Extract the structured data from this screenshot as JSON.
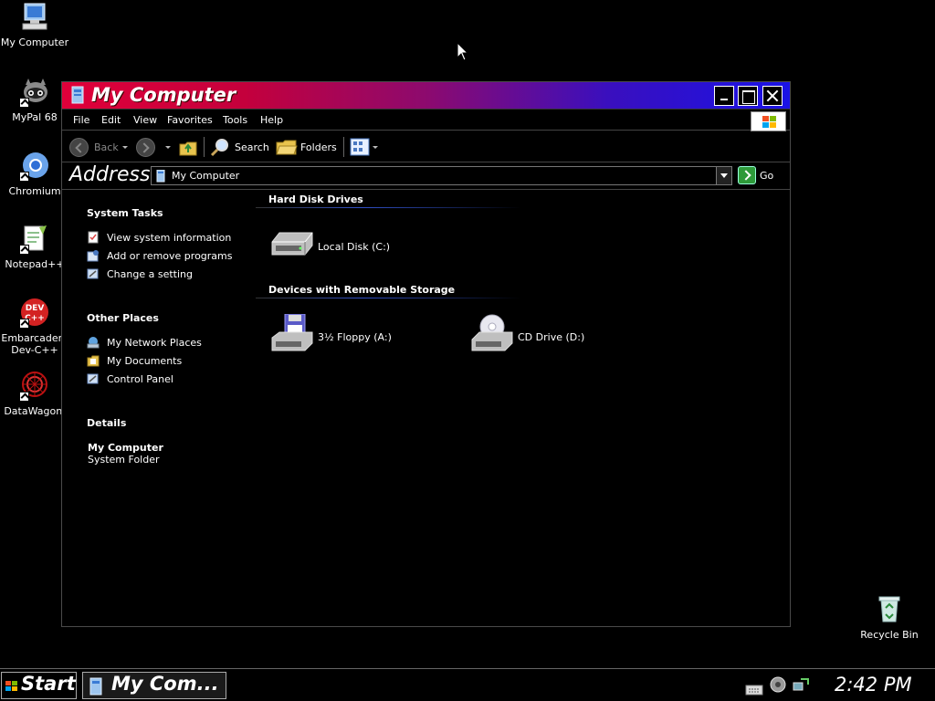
{
  "desktop": {
    "icons": [
      {
        "label": "My Computer"
      },
      {
        "label": "MyPal 68"
      },
      {
        "label": "Chromium"
      },
      {
        "label": "Notepad++"
      },
      {
        "label": "Embarcadero Dev-C++"
      },
      {
        "label": "DataWagon."
      },
      {
        "label": "Recycle Bin"
      }
    ]
  },
  "window": {
    "title": "My Computer",
    "menu": [
      "File",
      "Edit",
      "View",
      "Favorites",
      "Tools",
      "Help"
    ],
    "toolbar": {
      "back": "Back",
      "search": "Search",
      "folders": "Folders"
    },
    "address": {
      "label": "Address",
      "value": "My Computer",
      "go": "Go"
    },
    "taskpane": {
      "system_tasks": {
        "title": "System Tasks",
        "items": [
          "View system information",
          "Add or remove programs",
          "Change a setting"
        ]
      },
      "other_places": {
        "title": "Other Places",
        "items": [
          "My Network Places",
          "My Documents",
          "Control Panel"
        ]
      },
      "details": {
        "title": "Details",
        "name": "My Computer",
        "type": "System Folder"
      }
    },
    "groups": [
      {
        "title": "Hard Disk Drives",
        "items": [
          "Local Disk (C:)"
        ]
      },
      {
        "title": "Devices with Removable Storage",
        "items": [
          "3½ Floppy (A:)",
          "CD Drive (D:)"
        ]
      }
    ]
  },
  "taskbar": {
    "start": "Start",
    "task": "My Com...",
    "clock": "2:42 PM"
  },
  "colors": {
    "title_start": "#e0003a",
    "title_end": "#1a13e6",
    "group_line": "#3050c8"
  }
}
